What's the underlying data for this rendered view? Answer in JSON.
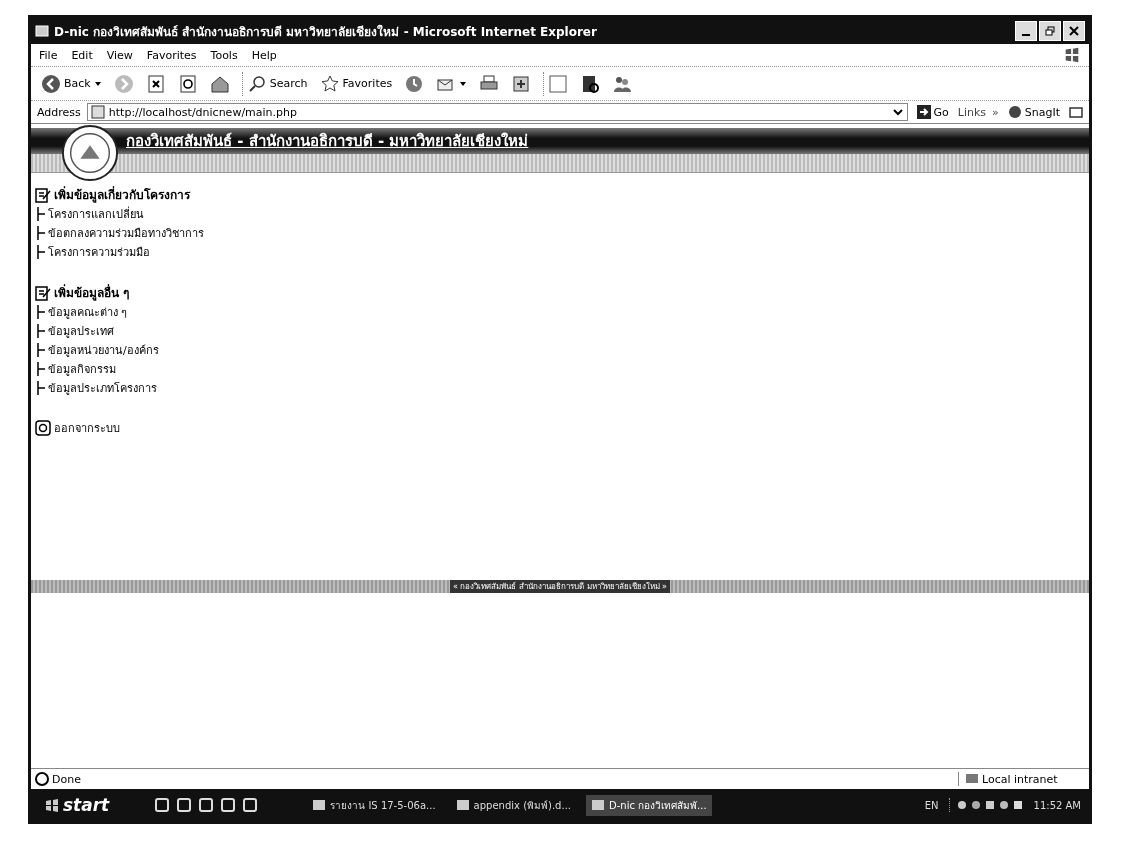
{
  "window": {
    "title": "D-nic กองวิเทศสัมพันธ์ สำนักงานอธิการบดี มหาวิทยาลัยเชียงใหม่ - Microsoft Internet Explorer"
  },
  "menu_bar": [
    "File",
    "Edit",
    "View",
    "Favorites",
    "Tools",
    "Help"
  ],
  "toolbar": [
    {
      "kind": "back",
      "label": "Back"
    },
    {
      "kind": "forward"
    },
    {
      "kind": "stop"
    },
    {
      "kind": "refresh"
    },
    {
      "kind": "home"
    },
    {
      "kind": "search",
      "label": "Search"
    },
    {
      "kind": "favorites",
      "label": "Favorites"
    },
    {
      "kind": "history"
    },
    {
      "kind": "mail"
    },
    {
      "kind": "print"
    },
    {
      "kind": "edit"
    },
    {
      "kind": "discuss"
    },
    {
      "kind": "research"
    },
    {
      "kind": "messenger"
    }
  ],
  "address_bar": {
    "label": "Address",
    "value": "http://localhost/dnicnew/main.php",
    "go": "Go",
    "links": "Links",
    "more": "»",
    "snagit": "SnagIt"
  },
  "page": {
    "banner": "กองวิเทศสัมพันธ์ - สำนักงานอธิการบดี - มหาวิทยาลัยเชียงใหม่",
    "sections": [
      {
        "title": "เพิ่มข้อมูลเกี่ยวกับโครงการ",
        "items": [
          "โครงการแลกเปลี่ยน",
          "ข้อตกลงความร่วมมือทางวิชาการ",
          "โครงการความร่วมมือ"
        ]
      },
      {
        "title": "เพิ่มข้อมูลอื่น ๆ",
        "items": [
          "ข้อมูลคณะต่าง ๆ",
          "ข้อมูลประเทศ",
          "ข้อมูลหน่วยงาน/องค์กร",
          "ข้อมูลกิจกรรม",
          "ข้อมูลประเภทโครงการ"
        ]
      }
    ],
    "logout": "ออกจากระบบ",
    "footer": "« กองวิเทศสัมพันธ์ สำนักงานอธิการบดี มหาวิทยาลัยเชียงใหม่ »"
  },
  "status_bar": {
    "text": "Done",
    "zone": "Local intranet"
  },
  "taskbar": {
    "start": "start",
    "tasks": [
      {
        "label": "รายงาน IS 17-5-06a...",
        "selected": false
      },
      {
        "label": "appendix (พิมพ์).d...",
        "selected": false
      },
      {
        "label": "D-nic กองวิเทศสัมพั...",
        "selected": true
      }
    ],
    "language": "EN",
    "clock": "11:52 AM"
  }
}
